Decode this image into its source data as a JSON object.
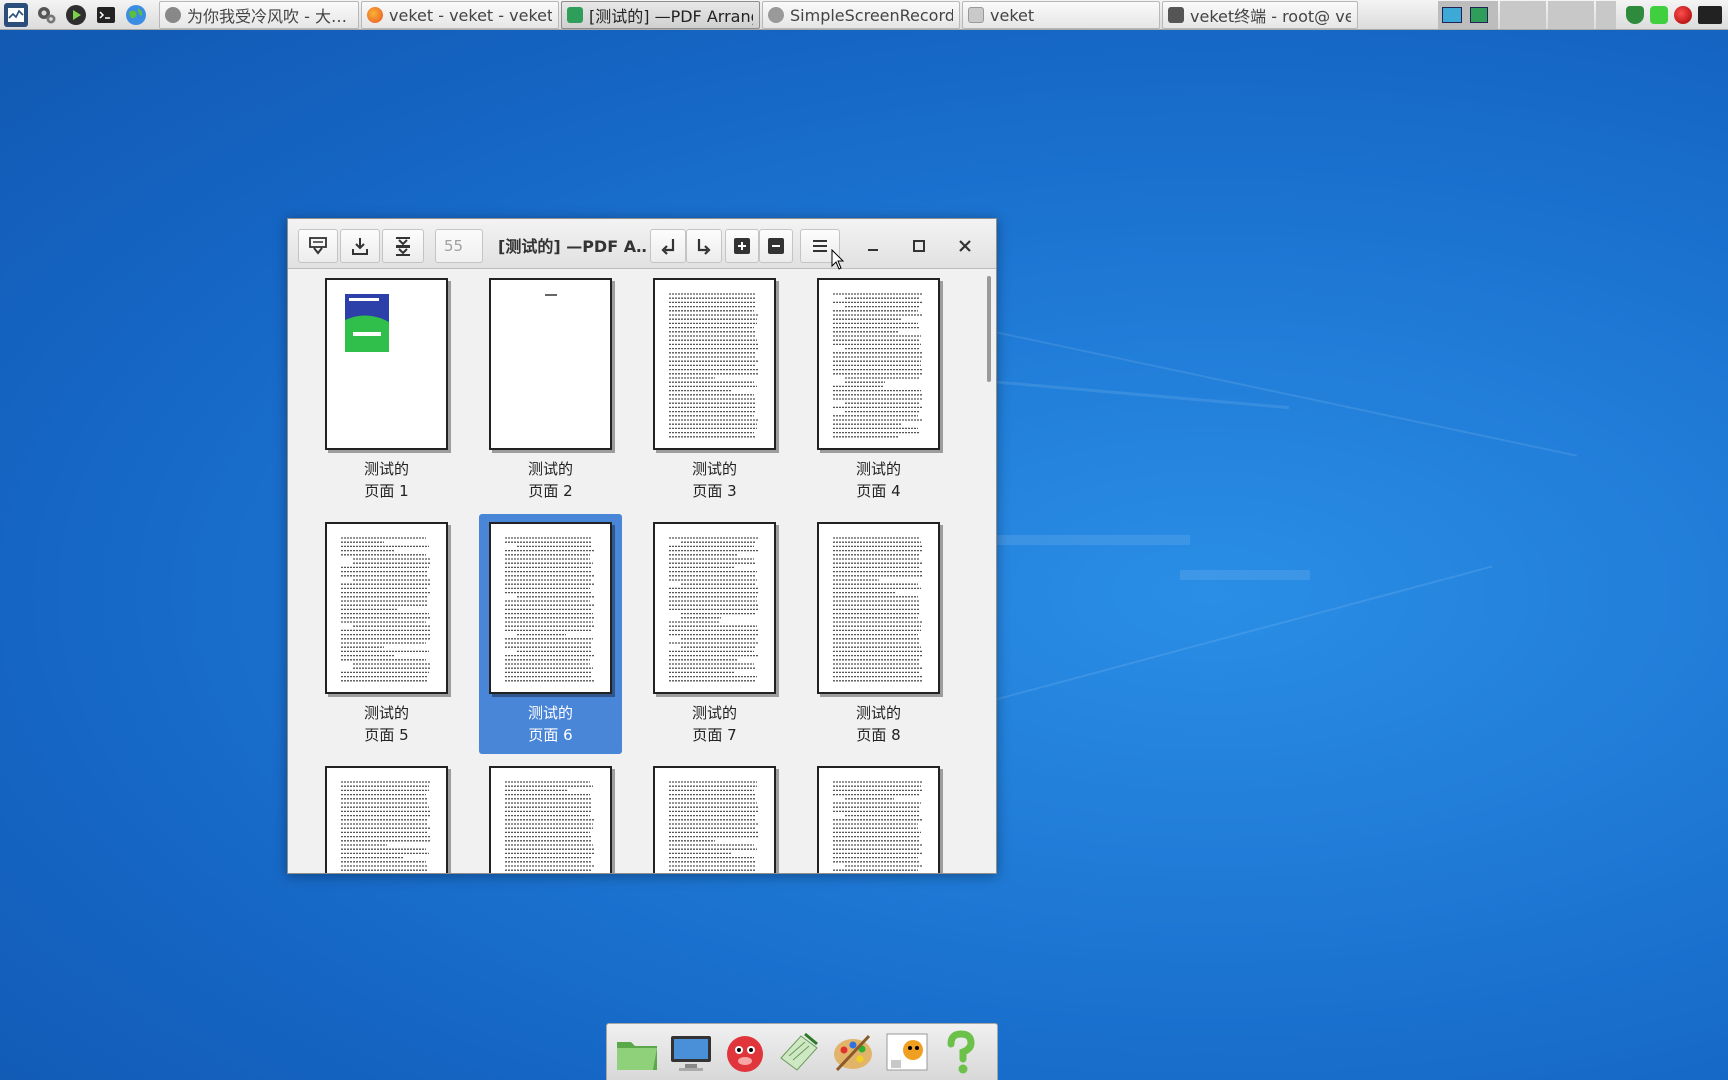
{
  "taskbar": {
    "launchers": [
      "system-monitor-icon",
      "settings-gears-icon",
      "media-play-icon",
      "terminal-icon",
      "web-browser-icon"
    ],
    "tasks": [
      {
        "label": "为你我受冷风吹 - 大…",
        "icon": "music-player-icon",
        "active": false
      },
      {
        "label": "veket - veket - veket …",
        "icon": "firefox-icon",
        "active": false
      },
      {
        "label": "[测试的] —PDF Arranger",
        "icon": "pdf-arranger-icon",
        "active": true
      },
      {
        "label": "SimpleScreenRecorder",
        "icon": "screen-recorder-icon",
        "active": false
      },
      {
        "label": "veket",
        "icon": "folder-icon",
        "active": false
      },
      {
        "label": "veket终端 - root@ vek…",
        "icon": "terminal-icon",
        "active": false
      }
    ]
  },
  "window": {
    "title": "[测试的] —PDF A…",
    "page_entry": "55",
    "buttons": {
      "save": "save-icon",
      "save_as": "save-as-icon",
      "export": "export-icon",
      "rotate_left": "rotate-left-icon",
      "rotate_right": "rotate-right-icon",
      "zoom_in": "zoom-in-icon",
      "zoom_out": "zoom-out-icon",
      "menu": "hamburger-menu-icon",
      "minimize": "minimize-icon",
      "maximize": "maximize-icon",
      "close": "close-icon"
    },
    "pages": [
      {
        "caption": "测试的\n页面 1",
        "kind": "cover",
        "selected": false
      },
      {
        "caption": "测试的\n页面 2",
        "kind": "blank",
        "selected": false
      },
      {
        "caption": "测试的\n页面 3",
        "kind": "text",
        "selected": false
      },
      {
        "caption": "测试的\n页面 4",
        "kind": "text",
        "selected": false
      },
      {
        "caption": "测试的\n页面 5",
        "kind": "text",
        "selected": false
      },
      {
        "caption": "测试的\n页面 6",
        "kind": "text",
        "selected": true
      },
      {
        "caption": "测试的\n页面 7",
        "kind": "text",
        "selected": false
      },
      {
        "caption": "测试的\n页面 8",
        "kind": "text",
        "selected": false
      },
      {
        "caption": "",
        "kind": "text",
        "selected": false
      },
      {
        "caption": "",
        "kind": "text",
        "selected": false
      },
      {
        "caption": "",
        "kind": "text",
        "selected": false
      },
      {
        "caption": "",
        "kind": "text",
        "selected": false
      }
    ]
  },
  "dock": {
    "items": [
      "file-manager-icon",
      "display-settings-icon",
      "mascot-icon",
      "text-editor-icon",
      "paint-palette-icon",
      "photo-viewer-icon",
      "help-icon"
    ]
  },
  "colors": {
    "desktop": "#1f7ad6",
    "selection": "#4a86d8",
    "cover_blue": "#2d3fa8",
    "cover_green": "#2fbf4a"
  }
}
